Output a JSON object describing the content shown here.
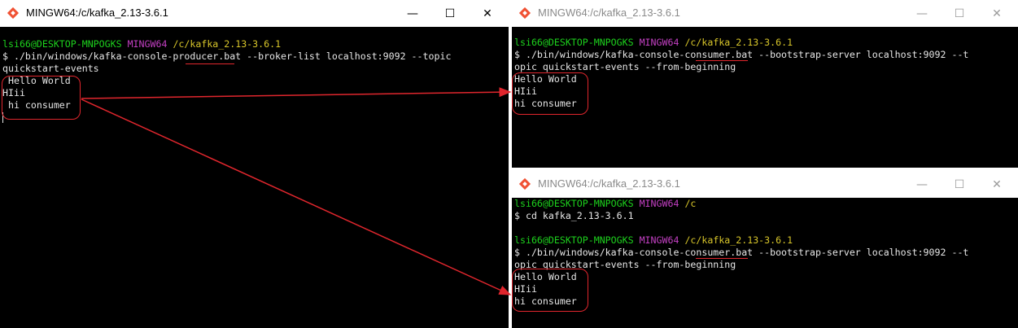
{
  "windows": {
    "producer": {
      "title": "MINGW64:/c/kafka_2.13-3.6.1",
      "controls": {
        "minimize": "—",
        "maximize": "☐",
        "close": "✕"
      },
      "prompt": {
        "user": "lsi66@DESKTOP-MNPOGKS",
        "env": "MINGW64",
        "path": "/c/kafka_2.13-3.6.1"
      },
      "command_line1": "$ ./bin/windows/kafka-console-producer.bat --broker-list localhost:9092 --topic",
      "command_line2": "quickstart-events",
      "messages": [
        " Hello World",
        "HIii",
        " hi consumer"
      ]
    },
    "consumer1": {
      "title": "MINGW64:/c/kafka_2.13-3.6.1",
      "controls": {
        "minimize": "—",
        "maximize": "☐",
        "close": "✕"
      },
      "prompt": {
        "user": "lsi66@DESKTOP-MNPOGKS",
        "env": "MINGW64",
        "path": "/c/kafka_2.13-3.6.1"
      },
      "command_line1": "$ ./bin/windows/kafka-console-consumer.bat --bootstrap-server localhost:9092 --t",
      "command_line2": "opic quickstart-events --from-beginning",
      "messages": [
        "Hello World",
        "HIii",
        "hi consumer"
      ]
    },
    "consumer2": {
      "title": "MINGW64:/c/kafka_2.13-3.6.1",
      "controls": {
        "minimize": "—",
        "maximize": "☐",
        "close": "✕"
      },
      "prompt1": {
        "user": "lsi66@DESKTOP-MNPOGKS",
        "env": "MINGW64",
        "path": "/c"
      },
      "cd_command": "$ cd kafka_2.13-3.6.1",
      "prompt2": {
        "user": "lsi66@DESKTOP-MNPOGKS",
        "env": "MINGW64",
        "path": "/c/kafka_2.13-3.6.1"
      },
      "command_line1": "$ ./bin/windows/kafka-console-consumer.bat --bootstrap-server localhost:9092 --t",
      "command_line2": "opic quickstart-events --from-beginning",
      "messages": [
        "Hello World",
        "HIii",
        "hi consumer"
      ]
    }
  },
  "colors": {
    "annotation": "#e0262d",
    "prompt_user": "#1dd21d",
    "prompt_env": "#c340c3",
    "prompt_path": "#d8c62a",
    "terminal_bg": "#000000",
    "terminal_text": "#e6e6e6"
  },
  "icons": {
    "app": "git-bash-diamond-icon"
  }
}
